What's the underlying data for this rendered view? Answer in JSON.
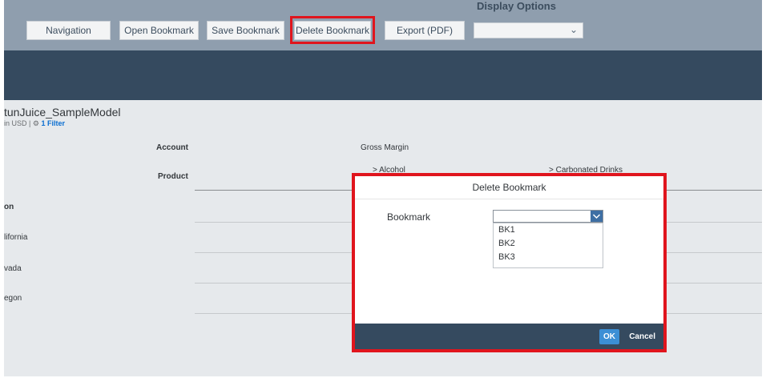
{
  "toolbar": {
    "buttons": [
      "Navigation",
      "Open Bookmark",
      "Save Bookmark",
      "Delete Bookmark",
      "Export (PDF)"
    ],
    "display_options_label": "Display Options",
    "display_select_value": ""
  },
  "report": {
    "model_title": "tunJuice_SampleModel",
    "model_sub": "in USD |",
    "filter_label": "1 Filter",
    "header_account": "Account",
    "header_product": "Product",
    "measure": "Gross Margin",
    "col_alcohol": "> Alcohol",
    "col_carbonated": "> Carbonated Drinks",
    "rows": [
      "on",
      "lifornia",
      "vada",
      "egon"
    ]
  },
  "dialog": {
    "title": "Delete Bookmark",
    "field_label": "Bookmark",
    "selected_value": "",
    "options": [
      "BK1",
      "BK2",
      "BK3"
    ],
    "ok_label": "OK",
    "cancel_label": "Cancel"
  }
}
